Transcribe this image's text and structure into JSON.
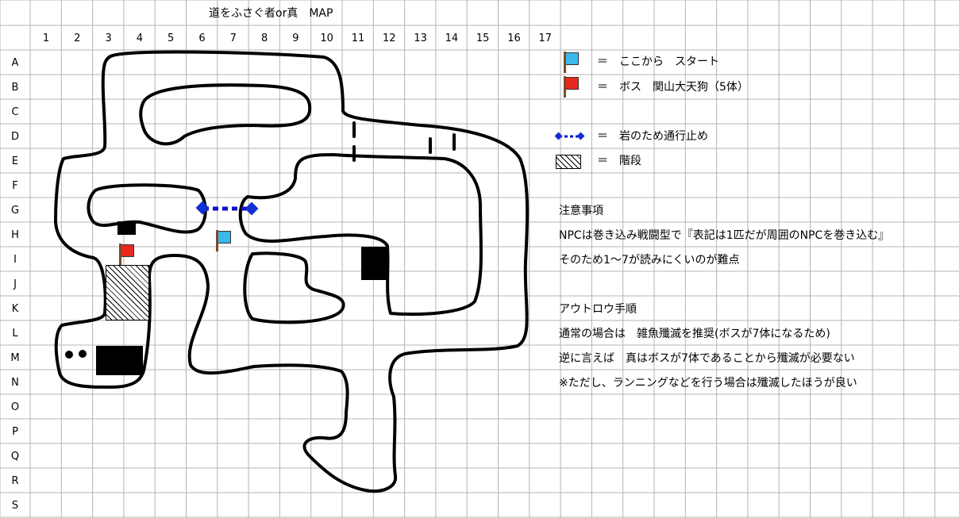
{
  "title": "道をふさぐ者or真　MAP",
  "columns": [
    "1",
    "2",
    "3",
    "4",
    "5",
    "6",
    "7",
    "8",
    "9",
    "10",
    "11",
    "12",
    "13",
    "14",
    "15",
    "16",
    "17"
  ],
  "rows": [
    "A",
    "B",
    "C",
    "D",
    "E",
    "F",
    "G",
    "H",
    "I",
    "J",
    "K",
    "L",
    "M",
    "N",
    "O",
    "P",
    "Q",
    "R",
    "S"
  ],
  "legend": {
    "start": "＝　ここから　スタート",
    "boss": "＝　ボス　関山大天狗（5体）",
    "blocked": "＝　岩のため通行止め",
    "stairs": "＝　階段"
  },
  "notes": {
    "caution_heading": "注意事項",
    "caution_1": "NPCは巻き込み戦闘型で『表記は1匹だが周囲のNPCを巻き込む』",
    "caution_2": "そのため1～7が読みにくいのが難点",
    "outlaw_heading": "アウトロウ手順",
    "outlaw_1": "通常の場合は　雑魚殲滅を推奨(ボスが7体になるため)",
    "outlaw_2": "逆に言えば　真はボスが7体であることから殲滅が必要ない",
    "outlaw_3": "※ただし、ランニングなどを行う場合は殲滅したほうが良い"
  },
  "colors": {
    "grid": "#b4b4b4",
    "start_flag": "#3ab8ec",
    "boss_flag": "#e8281e",
    "blocked_line": "#1010c8",
    "blocked_node": "#1030d0"
  }
}
